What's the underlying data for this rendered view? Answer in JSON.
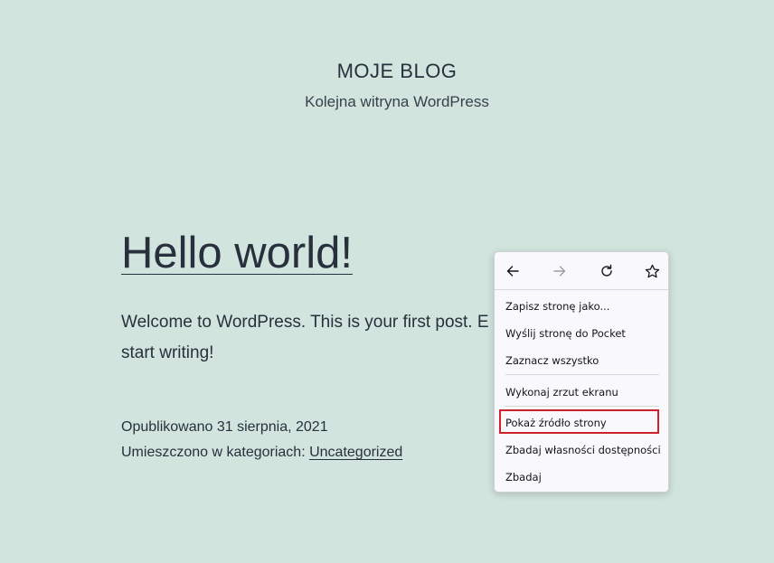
{
  "site": {
    "title": "MOJE BLOG",
    "description": "Kolejna witryna WordPress"
  },
  "post": {
    "title": "Hello world!",
    "body": "Welcome to WordPress. This is your first post. E",
    "body_line2": "start writing!",
    "published": "Opublikowano 31 sierpnia, 2021",
    "categories_label": "Umieszczono w kategoriach: ",
    "category": "Uncategorized"
  },
  "context_menu": {
    "nav_icons": [
      "back-arrow-icon",
      "forward-arrow-icon",
      "reload-icon",
      "bookmark-star-icon"
    ],
    "items": [
      {
        "label": "Zapisz stronę jako..."
      },
      {
        "label": "Wyślij stronę do Pocket"
      },
      {
        "label": "Zaznacz wszystko"
      },
      {
        "label": "Wykonaj zrzut ekranu"
      },
      {
        "label": "Pokaż źródło strony"
      },
      {
        "label": "Zbadaj własności dostępności"
      },
      {
        "label": "Zbadaj"
      }
    ],
    "highlight_color": "#d0202e"
  },
  "colors": {
    "background": "#d1e4dd",
    "text": "#28303d",
    "menu_bg": "#f9f9fb"
  }
}
